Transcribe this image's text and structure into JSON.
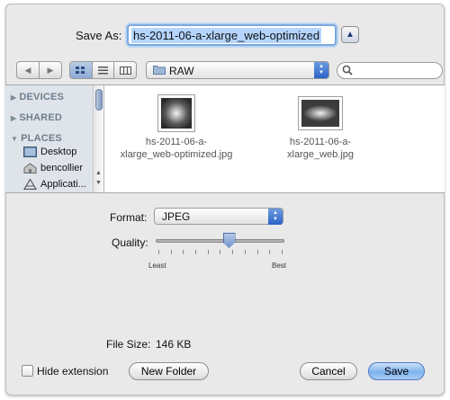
{
  "save_as": {
    "label": "Save As:",
    "value": "hs-2011-06-a-xlarge_web-optimized"
  },
  "toolbar": {
    "location": "RAW",
    "search_placeholder": ""
  },
  "sidebar": {
    "sections": [
      "DEVICES",
      "SHARED",
      "PLACES"
    ],
    "places": [
      "Desktop",
      "bencollier",
      "Applicati..."
    ]
  },
  "files": [
    {
      "name_line1": "hs-2011-06-a-",
      "name_line2": "xlarge_web-optimized.jpg"
    },
    {
      "name_line1": "hs-2011-06-a-",
      "name_line2": "xlarge_web.jpg"
    }
  ],
  "options": {
    "format_label": "Format:",
    "format_value": "JPEG",
    "quality_label": "Quality:",
    "quality_min": "Least",
    "quality_max": "Best",
    "quality_level": 0.57,
    "filesize_label": "File Size:",
    "filesize_value": "146 KB"
  },
  "footer": {
    "hide_extension": "Hide extension",
    "hide_extension_checked": false,
    "new_folder": "New Folder",
    "cancel": "Cancel",
    "save": "Save"
  },
  "colors": {
    "accent": "#7eb2ee",
    "sidebar_bg": "#dee4ea"
  }
}
